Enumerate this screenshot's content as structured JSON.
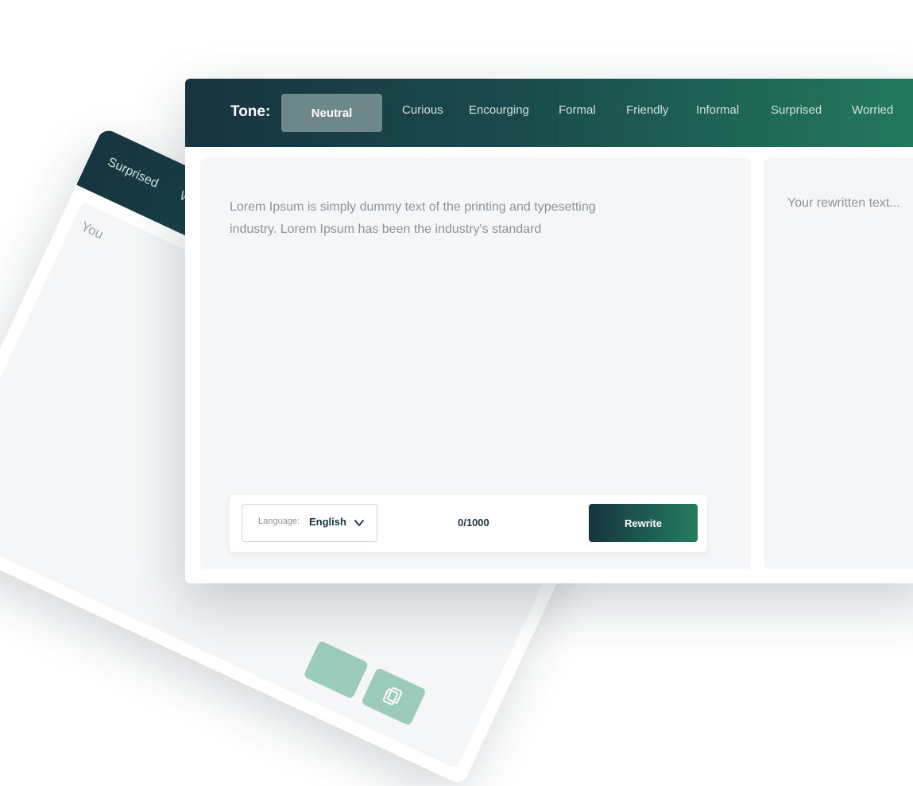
{
  "back_card": {
    "tabs": [
      "Surprised",
      "Worri"
    ],
    "placeholder": "You"
  },
  "tone_bar": {
    "label": "Tone:",
    "active": "Neutral",
    "tabs": [
      "Curious",
      "Encourging",
      "Formal",
      "Friendly",
      "Informal",
      "Surprised",
      "Worried"
    ]
  },
  "input": {
    "text": "Lorem Ipsum is simply dummy text of the printing and typesetting industry. Lorem Ipsum has been the industry's standard",
    "language_label": "Language:",
    "language_value": "English",
    "char_count": "0/1000",
    "rewrite_label": "Rewrite"
  },
  "output": {
    "placeholder": "Your rewritten text..."
  },
  "colors": {
    "header_start": "#17343f",
    "header_end": "#237a60",
    "active_tab": "#6e8788",
    "panel_bg": "#f4f6f8",
    "copy_button": "#9ccbbb"
  },
  "icons": [
    "chevron-down-icon",
    "copy-icon"
  ]
}
